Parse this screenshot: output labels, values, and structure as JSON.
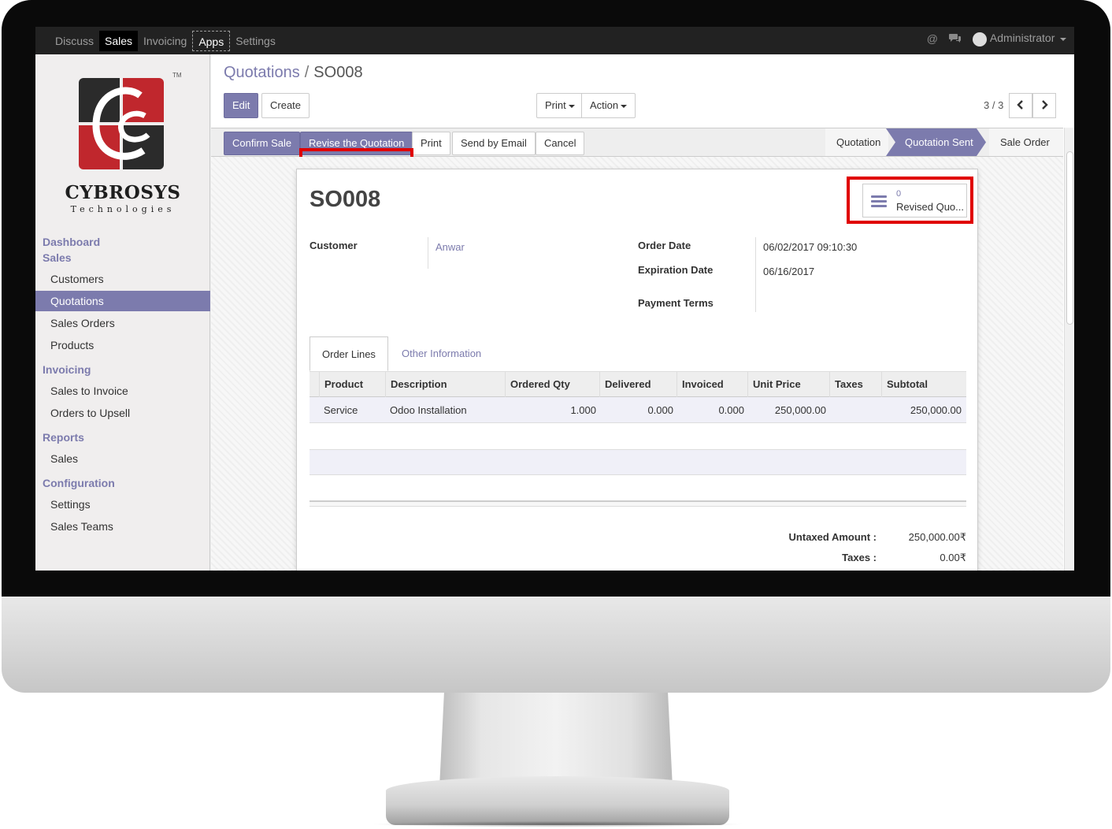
{
  "navbar": {
    "menu": [
      "Discuss",
      "Sales",
      "Invoicing",
      "Apps",
      "Settings"
    ],
    "user": "Administrator"
  },
  "sidebar": {
    "brand": "CYBROSYS",
    "brand_sub": "Technologies",
    "tm": "TM",
    "sections": [
      {
        "title": "Dashboard",
        "items": []
      },
      {
        "title": "Sales",
        "items": [
          "Customers",
          "Quotations",
          "Sales Orders",
          "Products"
        ]
      },
      {
        "title": "Invoicing",
        "items": [
          "Sales to Invoice",
          "Orders to Upsell"
        ]
      },
      {
        "title": "Reports",
        "items": [
          "Sales"
        ]
      },
      {
        "title": "Configuration",
        "items": [
          "Settings",
          "Sales Teams"
        ]
      }
    ],
    "selected": "Quotations"
  },
  "breadcrumb": {
    "parent": "Quotations",
    "current": "SO008"
  },
  "controls": {
    "edit": "Edit",
    "create": "Create",
    "print": "Print",
    "action": "Action",
    "pager": "3 / 3",
    "prev": "‹",
    "next": "›"
  },
  "statusbar": {
    "buttons": [
      "Confirm Sale",
      "Revise the Quotation",
      "Print",
      "Send by Email",
      "Cancel"
    ],
    "stages": [
      "Quotation",
      "Quotation Sent",
      "Sale Order"
    ],
    "current_stage": "Quotation Sent"
  },
  "record": {
    "name": "SO008",
    "smart_button": {
      "count": "0",
      "label": "Revised Quo..."
    },
    "customer_label": "Customer",
    "customer": "Anwar",
    "order_date_label": "Order Date",
    "order_date": "06/02/2017 09:10:30",
    "expiration_label": "Expiration Date",
    "expiration": "06/16/2017",
    "payment_terms_label": "Payment Terms"
  },
  "tabs": [
    "Order Lines",
    "Other Information"
  ],
  "order_lines": {
    "columns": [
      "Product",
      "Description",
      "Ordered Qty",
      "Delivered",
      "Invoiced",
      "Unit Price",
      "Taxes",
      "Subtotal"
    ],
    "rows": [
      [
        "Service",
        "Odoo Installation",
        "1.000",
        "0.000",
        "0.000",
        "250,000.00",
        "",
        "250,000.00"
      ]
    ]
  },
  "totals": {
    "untaxed_label": "Untaxed Amount :",
    "untaxed": "250,000.00₹",
    "taxes_label": "Taxes :",
    "taxes": "0.00₹"
  },
  "colors": {
    "accent": "#7c7bad",
    "highlight": "#e00000",
    "navbar": "#222222"
  }
}
